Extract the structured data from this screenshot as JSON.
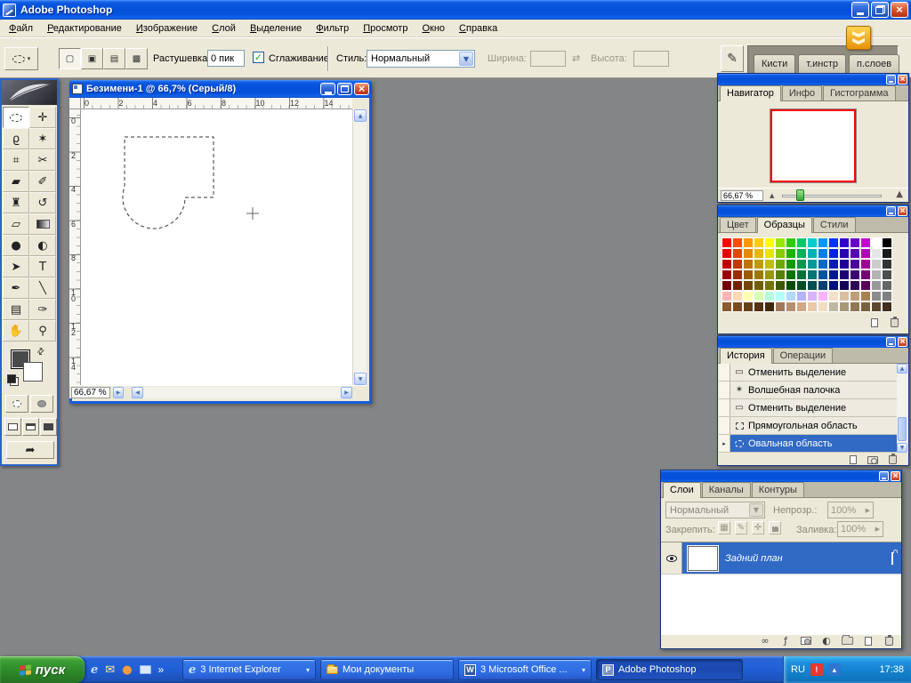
{
  "app": {
    "title": "Adobe Photoshop",
    "menu": [
      "Файл",
      "Редактирование",
      "Изображение",
      "Слой",
      "Выделение",
      "Фильтр",
      "Просмотр",
      "Окно",
      "Справка"
    ]
  },
  "options": {
    "feather_label": "Растушевка:",
    "feather_value": "0 пик",
    "antialias_label": "Сглаживание",
    "style_label": "Стиль:",
    "style_value": "Нормальный",
    "width_label": "Ширина:",
    "height_label": "Высота:",
    "mode_buttons": [
      "new-selection",
      "add-to-selection",
      "subtract-from-selection",
      "intersect-selection"
    ],
    "dock_tabs": [
      "Кисти",
      "т.инстр",
      "п.слоев"
    ]
  },
  "toolbox": {
    "tools": [
      {
        "name": "elliptical-marquee",
        "kind": "ellipse",
        "selected": true
      },
      {
        "name": "move",
        "glyph": "✛"
      },
      {
        "name": "lasso",
        "glyph": "ϱ"
      },
      {
        "name": "magic-wand",
        "glyph": "✶"
      },
      {
        "name": "crop",
        "glyph": "⌗"
      },
      {
        "name": "slice",
        "glyph": "✂"
      },
      {
        "name": "healing-brush",
        "glyph": "▰"
      },
      {
        "name": "brush",
        "glyph": "✐"
      },
      {
        "name": "clone-stamp",
        "glyph": "♜"
      },
      {
        "name": "history-brush",
        "glyph": "↺"
      },
      {
        "name": "eraser",
        "glyph": "▱"
      },
      {
        "name": "gradient",
        "kind": "gradient"
      },
      {
        "name": "blur",
        "glyph": "●"
      },
      {
        "name": "dodge",
        "glyph": "◐"
      },
      {
        "name": "path-selection",
        "glyph": "➤"
      },
      {
        "name": "type",
        "glyph": "T"
      },
      {
        "name": "pen",
        "glyph": "✒"
      },
      {
        "name": "line",
        "glyph": "╲"
      },
      {
        "name": "notes",
        "glyph": "▤"
      },
      {
        "name": "eyedropper",
        "glyph": "✑"
      },
      {
        "name": "hand",
        "glyph": "✋"
      },
      {
        "name": "zoom",
        "glyph": "⚲"
      }
    ]
  },
  "document": {
    "title": "Безимени-1 @ 66,7% (Серый/8)",
    "zoom": "66,67 %",
    "ruler_h": [
      "0",
      "2",
      "4",
      "6",
      "8",
      "10",
      "12",
      "14"
    ],
    "ruler_v": [
      "0",
      "2",
      "4",
      "6",
      "8",
      "10",
      "12",
      "14"
    ]
  },
  "navigator": {
    "tabs": [
      "Навигатор",
      "Инфо",
      "Гистограмма"
    ],
    "active": 0,
    "zoom": "66,67 %"
  },
  "swatches": {
    "tabs": [
      "Цвет",
      "Образцы",
      "Стили"
    ],
    "active": 1,
    "actions": [
      "new-swatch",
      "delete-swatch"
    ],
    "rows": [
      [
        "#ff0000",
        "#ff4d00",
        "#ff9900",
        "#ffcc00",
        "#ffff00",
        "#99e600",
        "#33cc00",
        "#00cc66",
        "#00cccc",
        "#0099ff",
        "#0033ff",
        "#3300cc",
        "#6600cc",
        "#cc00cc",
        "#ffffff",
        "#000000"
      ],
      [
        "#e60000",
        "#e64400",
        "#e68800",
        "#e6b800",
        "#e6e600",
        "#88cc00",
        "#22b300",
        "#00b359",
        "#00b3b3",
        "#0080e6",
        "#0022e6",
        "#2a00b3",
        "#5900b3",
        "#b300b3",
        "#e6e6e6",
        "#1a1a1a"
      ],
      [
        "#bf0000",
        "#bf3900",
        "#bf7200",
        "#bf9900",
        "#bfbf00",
        "#6fa800",
        "#189900",
        "#00994d",
        "#009999",
        "#006abf",
        "#001cbf",
        "#230099",
        "#4d0099",
        "#990099",
        "#cccccc",
        "#333333"
      ],
      [
        "#990000",
        "#992e00",
        "#995c00",
        "#997a00",
        "#999900",
        "#568000",
        "#0f7300",
        "#007339",
        "#007373",
        "#005499",
        "#001699",
        "#1b0073",
        "#3d0073",
        "#730073",
        "#b3b3b3",
        "#4d4d4d"
      ],
      [
        "#730000",
        "#732200",
        "#734500",
        "#735c00",
        "#737300",
        "#3d5900",
        "#084d00",
        "#004d26",
        "#004d4d",
        "#003f73",
        "#001073",
        "#140059",
        "#2e0059",
        "#590059",
        "#999999",
        "#666666"
      ],
      [
        "#ffb3b3",
        "#ffd9b3",
        "#ffffb3",
        "#d9ffb3",
        "#b3ffd9",
        "#b3ffff",
        "#b3d9ff",
        "#b3b3ff",
        "#d9b3ff",
        "#ffb3ff",
        "#f2e0c8",
        "#d9c0a0",
        "#bf9f78",
        "#a68050",
        "#8c8c8c",
        "#808080"
      ],
      [
        "#8c5a2b",
        "#7a4a20",
        "#684018",
        "#563310",
        "#44280c",
        "#a0785a",
        "#b89070",
        "#d0a888",
        "#e8c8a8",
        "#f2ddc0",
        "#c0b8a0",
        "#a89878",
        "#907850",
        "#786040",
        "#604830",
        "#403020"
      ]
    ]
  },
  "history": {
    "tabs": [
      "История",
      "Операции"
    ],
    "active": 0,
    "items": [
      {
        "label": "Отменить выделение",
        "icon": "deselect"
      },
      {
        "label": "Волшебная палочка",
        "icon": "wand"
      },
      {
        "label": "Отменить выделение",
        "icon": "deselect"
      },
      {
        "label": "Прямоугольная область",
        "icon": "rect-marquee"
      },
      {
        "label": "Овальная область",
        "icon": "ellipse-marquee",
        "selected": true
      }
    ],
    "bottom_icons": [
      "new-document-from-state",
      "new-snapshot",
      "delete-state"
    ]
  },
  "layers": {
    "tabs": [
      "Слои",
      "Каналы",
      "Контуры"
    ],
    "active": 0,
    "blend_mode": "Нормальный",
    "opacity_label": "Непрозр.:",
    "opacity_value": "100%",
    "lock_label": "Закрепить:",
    "fill_label": "Заливка:",
    "fill_value": "100%",
    "items": [
      {
        "name": "Задний план",
        "selected": true,
        "locked": true,
        "visible": true
      }
    ],
    "bottom_icons": [
      "link",
      "layer-style",
      "layer-mask",
      "adjustment-layer",
      "layer-set",
      "new-layer",
      "delete-layer"
    ]
  },
  "taskbar": {
    "start_label": "пуск",
    "quick_launch": [
      "internet-explorer",
      "outlook",
      "media-player",
      "show-desktop"
    ],
    "tasks": [
      {
        "label": "3 Internet Explorer",
        "icon": "ie",
        "grouped": true,
        "active": false
      },
      {
        "label": "Мои документы",
        "icon": "folder",
        "grouped": false,
        "active": false
      },
      {
        "label": "3 Microsoft Office ...",
        "icon": "word",
        "grouped": true,
        "active": false
      },
      {
        "label": "Adobe Photoshop",
        "icon": "photoshop",
        "grouped": false,
        "active": true
      }
    ],
    "language": "RU",
    "time": "17:38"
  },
  "colors": {
    "selection": "#316AC5",
    "navigator_proxy": "#ff0000",
    "foreground_swatch": "#4a4a4a",
    "background_swatch": "#ffffff"
  }
}
